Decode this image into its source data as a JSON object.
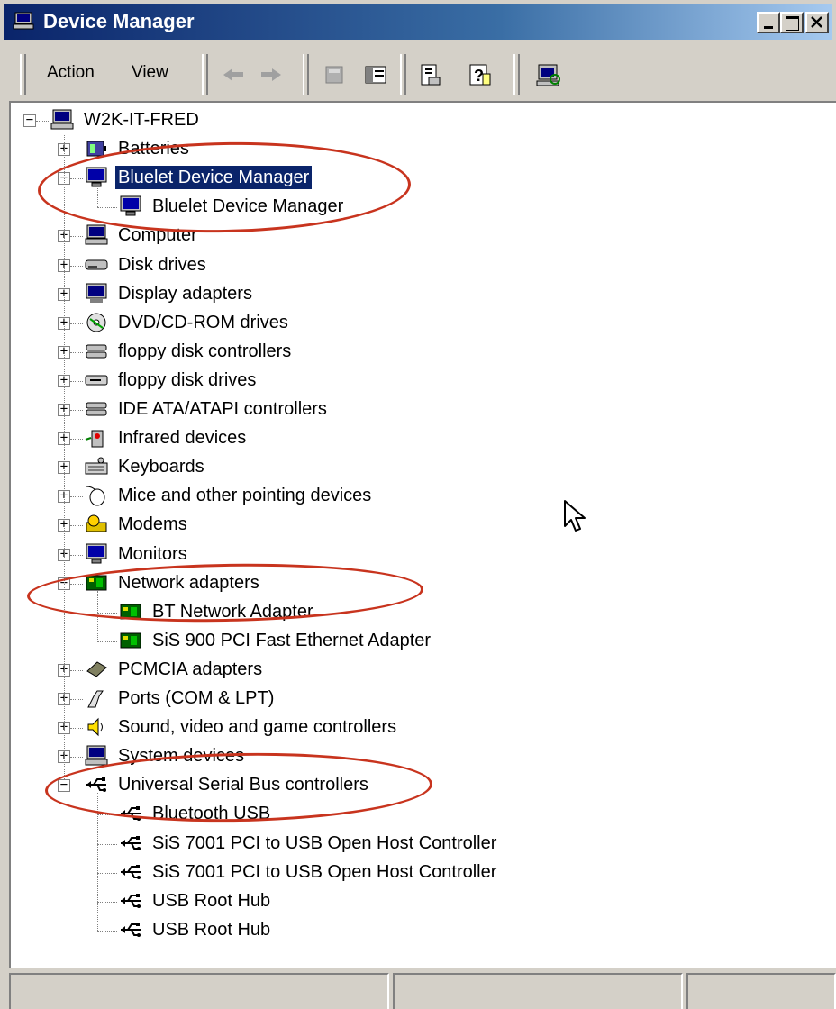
{
  "window": {
    "title": "Device Manager",
    "caption_buttons": [
      "minimize",
      "maximize",
      "close"
    ]
  },
  "menu": {
    "action": "Action",
    "view": "View"
  },
  "toolbar": {
    "buttons": [
      "back-icon",
      "forward-icon",
      "up-icon",
      "show-hide-tree-icon",
      "properties-icon",
      "help-icon",
      "scan-hardware-icon"
    ]
  },
  "tree": {
    "root": "W2K-IT-FRED",
    "nodes": [
      {
        "label": "Batteries",
        "icon": "battery-icon",
        "expanded": false
      },
      {
        "label": "Bluelet Device Manager",
        "icon": "monitor-icon",
        "expanded": true,
        "selected": true,
        "children": [
          {
            "label": "Bluelet Device Manager",
            "icon": "monitor-icon"
          }
        ]
      },
      {
        "label": "Computer",
        "icon": "computer-icon",
        "expanded": false
      },
      {
        "label": "Disk drives",
        "icon": "disk-drive-icon",
        "expanded": false
      },
      {
        "label": "Display adapters",
        "icon": "display-adapter-icon",
        "expanded": false
      },
      {
        "label": "DVD/CD-ROM drives",
        "icon": "cdrom-icon",
        "expanded": false
      },
      {
        "label": "floppy disk controllers",
        "icon": "floppy-controller-icon",
        "expanded": false
      },
      {
        "label": "floppy disk drives",
        "icon": "floppy-drive-icon",
        "expanded": false
      },
      {
        "label": "IDE ATA/ATAPI controllers",
        "icon": "ide-controller-icon",
        "expanded": false
      },
      {
        "label": "Infrared devices",
        "icon": "infrared-icon",
        "expanded": false
      },
      {
        "label": "Keyboards",
        "icon": "keyboard-icon",
        "expanded": false
      },
      {
        "label": "Mice and other pointing devices",
        "icon": "mouse-icon",
        "expanded": false
      },
      {
        "label": "Modems",
        "icon": "modem-icon",
        "expanded": false
      },
      {
        "label": "Monitors",
        "icon": "monitor-icon",
        "expanded": false
      },
      {
        "label": "Network adapters",
        "icon": "network-adapter-icon",
        "expanded": true,
        "children": [
          {
            "label": "BT Network Adapter",
            "icon": "network-adapter-icon"
          },
          {
            "label": "SiS 900 PCI Fast Ethernet Adapter",
            "icon": "network-adapter-icon"
          }
        ]
      },
      {
        "label": "PCMCIA adapters",
        "icon": "pcmcia-icon",
        "expanded": false
      },
      {
        "label": "Ports (COM & LPT)",
        "icon": "port-icon",
        "expanded": false
      },
      {
        "label": "Sound, video and game controllers",
        "icon": "sound-icon",
        "expanded": false
      },
      {
        "label": "System devices",
        "icon": "computer-icon",
        "expanded": false
      },
      {
        "label": "Universal Serial Bus controllers",
        "icon": "usb-icon",
        "expanded": true,
        "children": [
          {
            "label": "Bluetooth USB",
            "icon": "usb-icon"
          },
          {
            "label": "SiS 7001 PCI to USB Open Host Controller",
            "icon": "usb-icon"
          },
          {
            "label": "SiS 7001 PCI to USB Open Host Controller",
            "icon": "usb-icon"
          },
          {
            "label": "USB Root Hub",
            "icon": "usb-icon"
          },
          {
            "label": "USB Root Hub",
            "icon": "usb-icon"
          }
        ]
      }
    ]
  },
  "colors": {
    "title_start": "#0a246a",
    "title_end": "#a6caf0",
    "selection": "#0a246a",
    "annotation": "#c8341e",
    "face": "#d4d0c8"
  }
}
